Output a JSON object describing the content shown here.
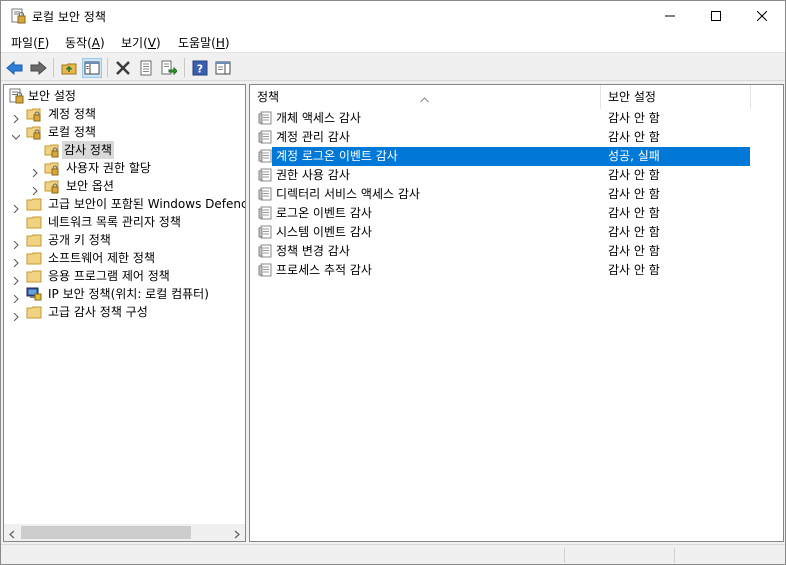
{
  "window": {
    "title": "로컬 보안 정책"
  },
  "menu": [
    {
      "label": "파일(",
      "key": "F",
      "end": ")"
    },
    {
      "label": "동작(",
      "key": "A",
      "end": ")"
    },
    {
      "label": "보기(",
      "key": "V",
      "end": ")"
    },
    {
      "label": "도움말(",
      "key": "H",
      "end": ")"
    }
  ],
  "toolbar": {
    "icons": [
      "back-arrow-icon",
      "forward-arrow-icon",
      "up-folder-icon",
      "show-hide-tree-icon",
      "delete-icon",
      "properties-icon",
      "export-list-icon",
      "help-icon",
      "view-icon"
    ]
  },
  "tree": {
    "root": "보안 설정",
    "items": [
      {
        "label": "계정 정책"
      },
      {
        "label": "로컬 정책"
      },
      {
        "label": "감사 정책"
      },
      {
        "label": "사용자 권한 할당"
      },
      {
        "label": "보안 옵션"
      },
      {
        "label": "고급 보안이 포함된 Windows Defenc"
      },
      {
        "label": "네트워크 목록 관리자 정책"
      },
      {
        "label": "공개 키 정책"
      },
      {
        "label": "소프트웨어 제한 정책"
      },
      {
        "label": "응용 프로그램 제어 정책"
      },
      {
        "label": "IP 보안 정책(위치: 로컬 컴퓨터)"
      },
      {
        "label": "고급 감사 정책 구성"
      }
    ]
  },
  "list": {
    "columns": {
      "policy": "정책",
      "setting": "보안 설정"
    },
    "rows": [
      {
        "name": "개체 액세스 감사",
        "value": "감사 안 함"
      },
      {
        "name": "계정 관리 감사",
        "value": "감사 안 함"
      },
      {
        "name": "계정 로그온 이벤트 감사",
        "value": "성공, 실패"
      },
      {
        "name": "권한 사용 감사",
        "value": "감사 안 함"
      },
      {
        "name": "디렉터리 서비스 액세스 감사",
        "value": "감사 안 함"
      },
      {
        "name": "로그온 이벤트 감사",
        "value": "감사 안 함"
      },
      {
        "name": "시스템 이벤트 감사",
        "value": "감사 안 함"
      },
      {
        "name": "정책 변경 감사",
        "value": "감사 안 함"
      },
      {
        "name": "프로세스 추적 감사",
        "value": "감사 안 함"
      }
    ]
  },
  "colors": {
    "selection": "#0078d7",
    "tree_selection": "#d9d9d9",
    "folder": "#e8b64d"
  }
}
